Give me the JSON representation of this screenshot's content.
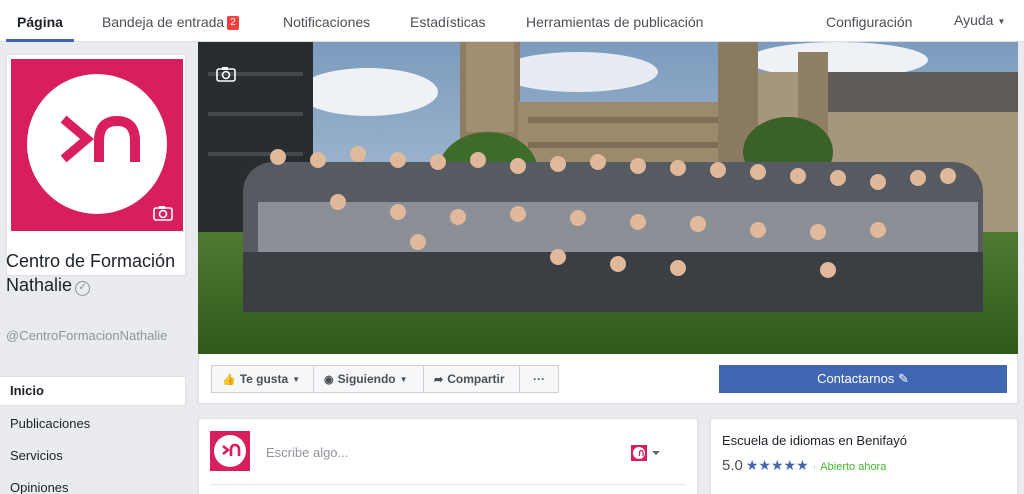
{
  "tabs": [
    {
      "label": "Página"
    },
    {
      "label": "Bandeja de entrada",
      "badge": "2"
    },
    {
      "label": "Notificaciones"
    },
    {
      "label": "Estadísticas"
    },
    {
      "label": "Herramientas de publicación"
    },
    {
      "label": "Configuración"
    },
    {
      "label": "Ayuda"
    }
  ],
  "page": {
    "name": "Centro de Formación Nathalie",
    "handle": "@CentroFormacionNathalie",
    "brand_color": "#d81e5b",
    "logo_icon": "nathalie-logo-icon"
  },
  "nav": [
    {
      "label": "Inicio"
    },
    {
      "label": "Publicaciones"
    },
    {
      "label": "Servicios"
    },
    {
      "label": "Opiniones"
    }
  ],
  "actions": {
    "like": "Te gusta",
    "following": "Siguiendo",
    "share": "Compartir",
    "more": "···",
    "contact": "Contactarnos"
  },
  "composer": {
    "placeholder": "Escribe algo..."
  },
  "info": {
    "category": "Escuela de idiomas en Benifayó",
    "rating": "5.0",
    "stars": "★★★★★",
    "separator": "·",
    "status": "Abierto ahora"
  },
  "colors": {
    "accent": "#4267b2",
    "open": "#42b72a"
  }
}
